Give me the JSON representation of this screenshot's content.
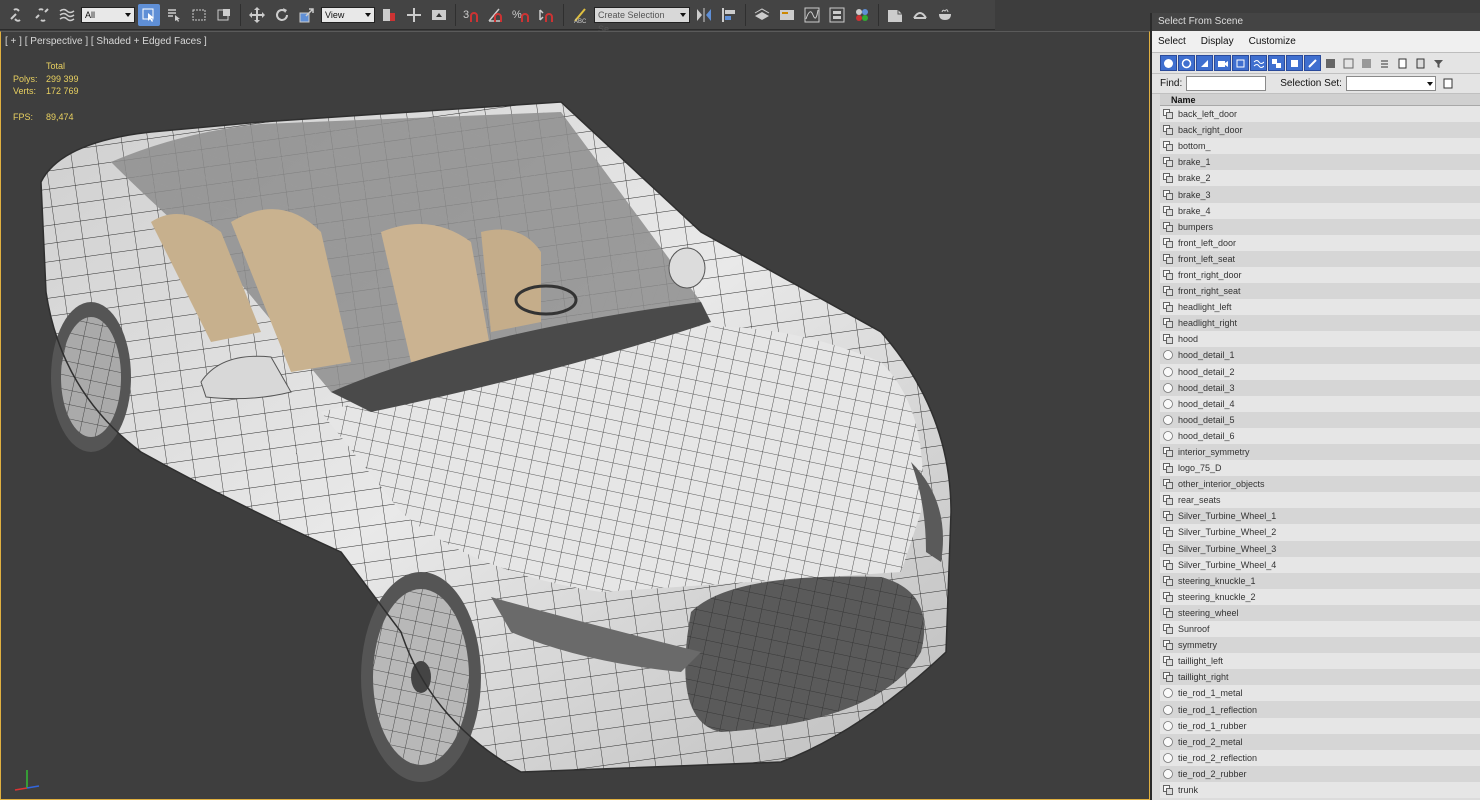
{
  "toolbar": {
    "filter_dropdown": "All",
    "coord_dropdown": "View",
    "selection_set_dropdown": "Create Selection Se",
    "accent_color": "#5f8fd6"
  },
  "viewport": {
    "label": "[ + ] [ Perspective ] [ Shaded + Edged Faces ]",
    "stats": {
      "header": "Total",
      "polys_label": "Polys:",
      "polys_value": "299 399",
      "verts_label": "Verts:",
      "verts_value": "172 769",
      "fps_label": "FPS:",
      "fps_value": "89,474"
    },
    "border_color": "#e0b040"
  },
  "panel": {
    "title": "Select From Scene",
    "menu": [
      "Select",
      "Display",
      "Customize"
    ],
    "find_label": "Find:",
    "selection_set_label": "Selection Set:",
    "column_name": "Name",
    "items": [
      {
        "name": "back_left_door",
        "icon": "mesh"
      },
      {
        "name": "back_right_door",
        "icon": "mesh"
      },
      {
        "name": "bottom_",
        "icon": "mesh"
      },
      {
        "name": "brake_1",
        "icon": "mesh"
      },
      {
        "name": "brake_2",
        "icon": "mesh"
      },
      {
        "name": "brake_3",
        "icon": "mesh"
      },
      {
        "name": "brake_4",
        "icon": "mesh"
      },
      {
        "name": "bumpers",
        "icon": "mesh"
      },
      {
        "name": "front_left_door",
        "icon": "mesh"
      },
      {
        "name": "front_left_seat",
        "icon": "mesh"
      },
      {
        "name": "front_right_door",
        "icon": "mesh"
      },
      {
        "name": "front_right_seat",
        "icon": "mesh"
      },
      {
        "name": "headlight_left",
        "icon": "mesh"
      },
      {
        "name": "headlight_right",
        "icon": "mesh"
      },
      {
        "name": "hood",
        "icon": "mesh"
      },
      {
        "name": "hood_detail_1",
        "icon": "sphere"
      },
      {
        "name": "hood_detail_2",
        "icon": "sphere"
      },
      {
        "name": "hood_detail_3",
        "icon": "sphere"
      },
      {
        "name": "hood_detail_4",
        "icon": "sphere"
      },
      {
        "name": "hood_detail_5",
        "icon": "sphere"
      },
      {
        "name": "hood_detail_6",
        "icon": "sphere"
      },
      {
        "name": "interior_symmetry",
        "icon": "mesh"
      },
      {
        "name": "logo_75_D",
        "icon": "mesh"
      },
      {
        "name": "other_interior_objects",
        "icon": "mesh"
      },
      {
        "name": "rear_seats",
        "icon": "mesh"
      },
      {
        "name": "Silver_Turbine_Wheel_1",
        "icon": "mesh"
      },
      {
        "name": "Silver_Turbine_Wheel_2",
        "icon": "mesh"
      },
      {
        "name": "Silver_Turbine_Wheel_3",
        "icon": "mesh"
      },
      {
        "name": "Silver_Turbine_Wheel_4",
        "icon": "mesh"
      },
      {
        "name": "steering_knuckle_1",
        "icon": "mesh"
      },
      {
        "name": "steering_knuckle_2",
        "icon": "mesh"
      },
      {
        "name": "steering_wheel",
        "icon": "mesh"
      },
      {
        "name": "Sunroof",
        "icon": "mesh"
      },
      {
        "name": "symmetry",
        "icon": "mesh"
      },
      {
        "name": "taillight_left",
        "icon": "mesh"
      },
      {
        "name": "taillight_right",
        "icon": "mesh"
      },
      {
        "name": "tie_rod_1_metal",
        "icon": "sphere"
      },
      {
        "name": "tie_rod_1_reflection",
        "icon": "sphere"
      },
      {
        "name": "tie_rod_1_rubber",
        "icon": "sphere"
      },
      {
        "name": "tie_rod_2_metal",
        "icon": "sphere"
      },
      {
        "name": "tie_rod_2_reflection",
        "icon": "sphere"
      },
      {
        "name": "tie_rod_2_rubber",
        "icon": "sphere"
      },
      {
        "name": "trunk",
        "icon": "mesh"
      }
    ]
  }
}
